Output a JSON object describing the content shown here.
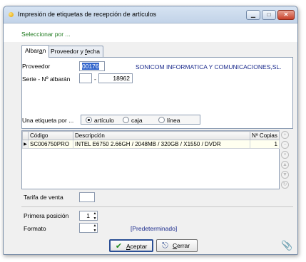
{
  "window": {
    "title": "Impresión de etiquetas de recepción de artículos",
    "controls": {
      "minimize": "▁",
      "maximize": "□",
      "close": "✕"
    }
  },
  "section_label": "Seleccionar por ...",
  "tabs": [
    {
      "label_pre": "Albar",
      "label_u": "a",
      "label_post": "n",
      "active": true
    },
    {
      "label_pre": "Proveedor y ",
      "label_u": "f",
      "label_post": "echa",
      "active": false
    }
  ],
  "form": {
    "proveedor_label": "Proveedor",
    "proveedor_value": "00176",
    "proveedor_name": "SONICOM INFORMATICA Y COMUNICACIONES,SL.",
    "serie_label": "Serie - Nº albarán",
    "serie_value": "",
    "serie_sep": "-",
    "albaran_value": "18962",
    "etiqueta_label": "Una etiqueta por ...",
    "etiqueta_options": [
      "artículo",
      "caja",
      "línea"
    ],
    "etiqueta_selected": "artículo"
  },
  "grid": {
    "columns": [
      "Código",
      "Descripción",
      "Nº Copias"
    ],
    "rows": [
      {
        "marker": "▶",
        "codigo": "SC006750PRO",
        "descripcion": "INTEL E6750 2.66GH / 2048MB / 320GB / X1550 / DVDR",
        "copias": "1"
      }
    ]
  },
  "tarifa": {
    "label": "Tarifa de venta",
    "value": ""
  },
  "posicion": {
    "label": "Primera posición",
    "value": "1"
  },
  "formato": {
    "label": "Formato",
    "value": "",
    "default_text": "[Predeterminado]"
  },
  "buttons": {
    "aceptar_pre": "",
    "aceptar_u": "A",
    "aceptar_post": "ceptar",
    "cerrar_pre": "",
    "cerrar_u": "C",
    "cerrar_post": "errar"
  },
  "icons": {
    "window": "app-icon",
    "aceptar": "check-icon",
    "cerrar": "exit-icon",
    "attachment": "paperclip-icon",
    "side_buttons": [
      "add-icon",
      "remove-icon",
      "delete-icon",
      "move-up-icon",
      "move-down-icon",
      "refresh-icon"
    ]
  },
  "colors": {
    "section_label": "#1f7a1f",
    "proveedor_name": "#1a2a8c",
    "selection": "#3366cc",
    "grid_row": "#fffff0"
  }
}
